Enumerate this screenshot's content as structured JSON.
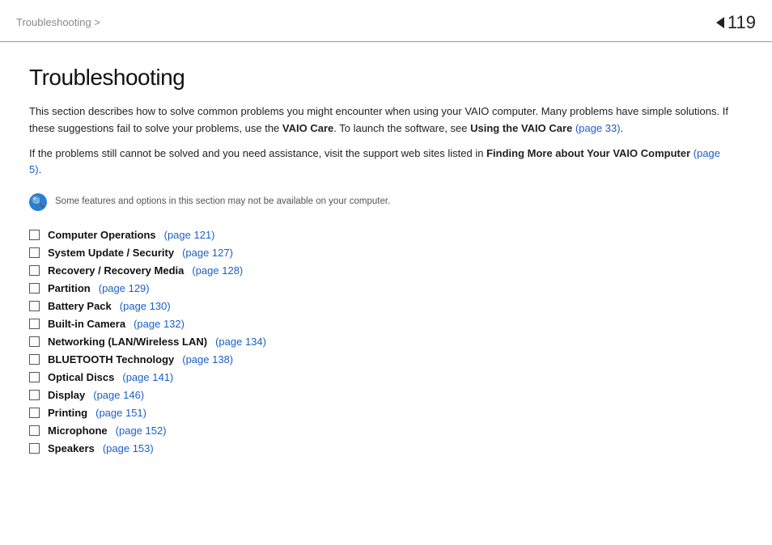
{
  "header": {
    "breadcrumb": "Troubleshooting >",
    "page_number": "119"
  },
  "page": {
    "title": "Troubleshooting",
    "intro_paragraph1_plain1": "This section describes how to solve common problems you might encounter when using your VAIO computer. Many problems have simple solutions. If these suggestions fail to solve your problems, use the ",
    "intro_bold1": "VAIO Care",
    "intro_paragraph1_plain2": ". To launch the software, see ",
    "intro_bold2": "Using the VAIO Care",
    "intro_link1_text": "(page 33)",
    "intro_paragraph1_plain3": ".",
    "intro_paragraph2_plain1": "If the problems still cannot be solved and you need assistance, visit the support web sites listed in ",
    "intro_bold3": "Finding More about Your VAIO Computer",
    "intro_link2_text": "(page 5)",
    "intro_paragraph2_plain2": ".",
    "note_text": "Some features and options in this section may not be available on your computer.",
    "toc": [
      {
        "label": "Computer Operations",
        "link_text": "(page 121)"
      },
      {
        "label": "System Update / Security",
        "link_text": "(page 127)"
      },
      {
        "label": "Recovery / Recovery Media",
        "link_text": "(page 128)"
      },
      {
        "label": "Partition",
        "link_text": "(page 129)"
      },
      {
        "label": "Battery Pack",
        "link_text": "(page 130)"
      },
      {
        "label": "Built-in Camera",
        "link_text": "(page 132)"
      },
      {
        "label": "Networking (LAN/Wireless LAN)",
        "link_text": "(page 134)"
      },
      {
        "label": "BLUETOOTH Technology",
        "link_text": "(page 138)"
      },
      {
        "label": "Optical Discs",
        "link_text": "(page 141)"
      },
      {
        "label": "Display",
        "link_text": "(page 146)"
      },
      {
        "label": "Printing",
        "link_text": "(page 151)"
      },
      {
        "label": "Microphone",
        "link_text": "(page 152)"
      },
      {
        "label": "Speakers",
        "link_text": "(page 153)"
      }
    ]
  }
}
